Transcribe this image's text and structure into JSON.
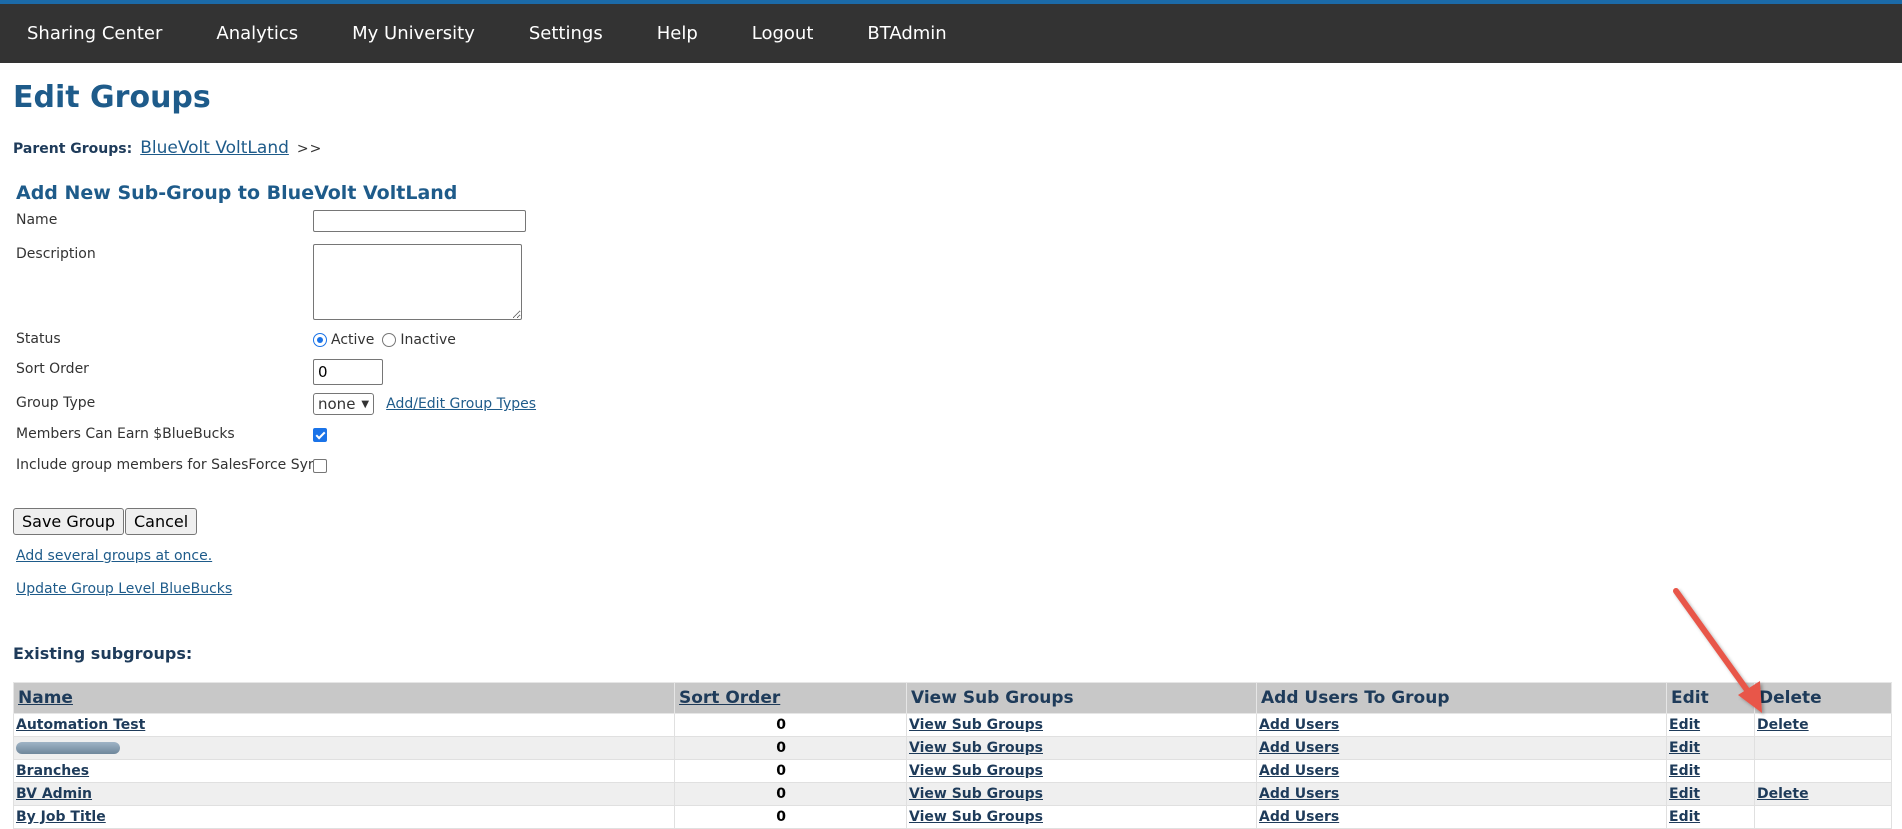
{
  "nav": {
    "items": [
      "Sharing Center",
      "Analytics",
      "My University",
      "Settings",
      "Help",
      "Logout",
      "BTAdmin"
    ]
  },
  "page": {
    "title": "Edit Groups",
    "breadcrumb_label": "Parent Groups:",
    "breadcrumb_link": "BlueVolt VoltLand",
    "breadcrumb_sep": ">>"
  },
  "form": {
    "title": "Add New Sub-Group to BlueVolt VoltLand",
    "name_label": "Name",
    "name_value": "",
    "description_label": "Description",
    "status_label": "Status",
    "status_active": "Active",
    "status_inactive": "Inactive",
    "status_selected": "Active",
    "sort_label": "Sort Order",
    "sort_value": "0",
    "group_type_label": "Group Type",
    "group_type_value": "none",
    "group_type_link": "Add/Edit Group Types",
    "bluebucks_label": "Members Can Earn $BlueBucks",
    "bluebucks_checked": true,
    "salesforce_label": "Include group members for SalesForce Sync",
    "salesforce_checked": false,
    "save_label": "Save Group",
    "cancel_label": "Cancel",
    "add_several_link": "Add several groups at once.",
    "update_bluebucks_link": "Update Group Level BlueBucks"
  },
  "existing": {
    "title": "Existing subgroups:",
    "columns": [
      "Name",
      "Sort Order",
      "View Sub Groups",
      "Add Users To Group",
      "Edit",
      "Delete"
    ],
    "rows": [
      {
        "name": "Automation Test",
        "sort": "0",
        "view": "View Sub Groups",
        "add": "Add Users",
        "edit": "Edit",
        "delete": "Delete"
      },
      {
        "name": "",
        "sort": "0",
        "view": "View Sub Groups",
        "add": "Add Users",
        "edit": "Edit",
        "delete": ""
      },
      {
        "name": "Branches",
        "sort": "0",
        "view": "View Sub Groups",
        "add": "Add Users",
        "edit": "Edit",
        "delete": ""
      },
      {
        "name": "BV Admin",
        "sort": "0",
        "view": "View Sub Groups",
        "add": "Add Users",
        "edit": "Edit",
        "delete": "Delete"
      },
      {
        "name": "By Job Title",
        "sort": "0",
        "view": "View Sub Groups",
        "add": "Add Users",
        "edit": "Edit",
        "delete": ""
      }
    ]
  },
  "colors": {
    "nav_bg": "#333333",
    "accent": "#1e5b8a",
    "arrow": "#e8574a"
  }
}
